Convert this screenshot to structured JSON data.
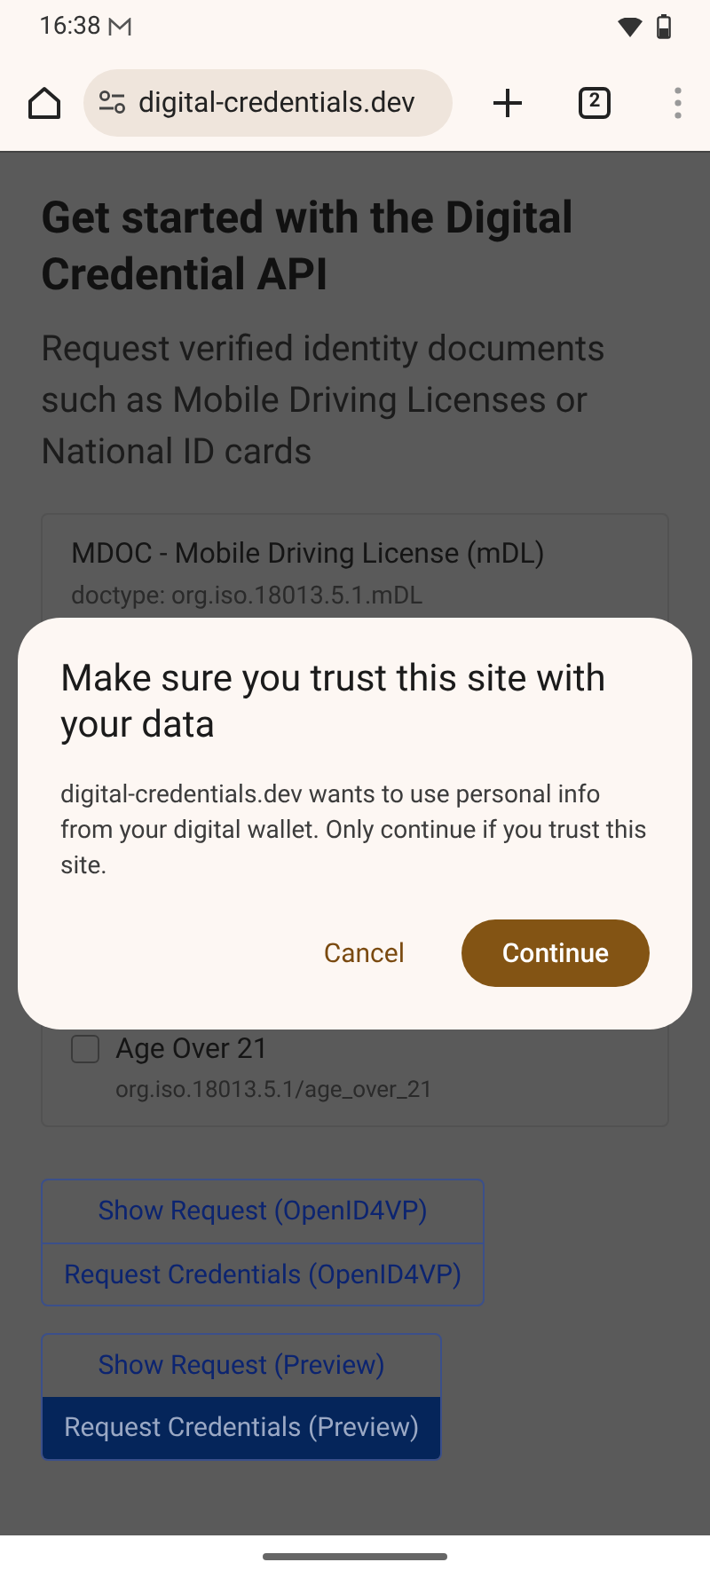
{
  "status_bar": {
    "time": "16:38"
  },
  "toolbar": {
    "url": "digital-credentials.dev",
    "tab_count": "2"
  },
  "page": {
    "heading": "Get started with the Digital Credential API",
    "subtitle": "Request verified identity documents such as Mobile Driving Licenses or National ID cards",
    "card": {
      "title": "MDOC - Mobile Driving License (mDL)",
      "doctype": "doctype: org.iso.18013.5.1.mDL",
      "fields": [
        {
          "label": "Age Over 21",
          "path": "org.iso.18013.5.1/age_over_21",
          "checked": false
        }
      ]
    },
    "button_groups": [
      {
        "buttons": [
          {
            "label": "Show Request (OpenID4VP)",
            "primary": false
          },
          {
            "label": "Request Credentials (OpenID4VP)",
            "primary": false
          }
        ]
      },
      {
        "buttons": [
          {
            "label": "Show Request (Preview)",
            "primary": false
          },
          {
            "label": "Request Credentials (Preview)",
            "primary": true
          }
        ]
      }
    ]
  },
  "dialog": {
    "title": "Make sure you trust this site with your data",
    "message": "digital-credentials.dev wants to use personal info from your digital wallet. Only continue if you trust this site.",
    "buttons": [
      {
        "label": "Cancel",
        "kind": "text"
      },
      {
        "label": "Continue",
        "kind": "filled"
      }
    ]
  }
}
